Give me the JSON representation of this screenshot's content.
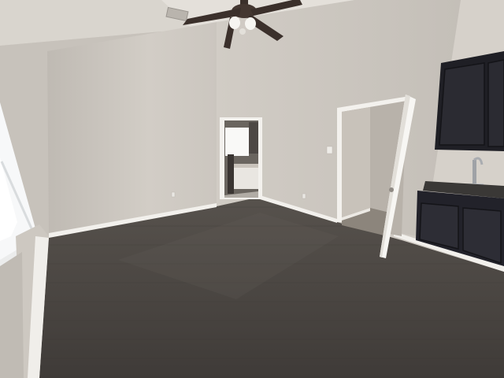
{
  "photo": {
    "subject": "empty-bedroom-interior",
    "colors": {
      "ceiling": "#dcd8d1",
      "wall_back": "#cbc6bf",
      "wall_right": "#d3cec7",
      "wall_left": "#c3beb7",
      "floor": "#4a4541",
      "floor_light": "#6b655f",
      "trim": "#f4f2ee",
      "cabinet": "#24242a",
      "countertop": "#3a3836",
      "window_light": "#f7f8f9",
      "fan_blade": "#3b302b"
    }
  }
}
